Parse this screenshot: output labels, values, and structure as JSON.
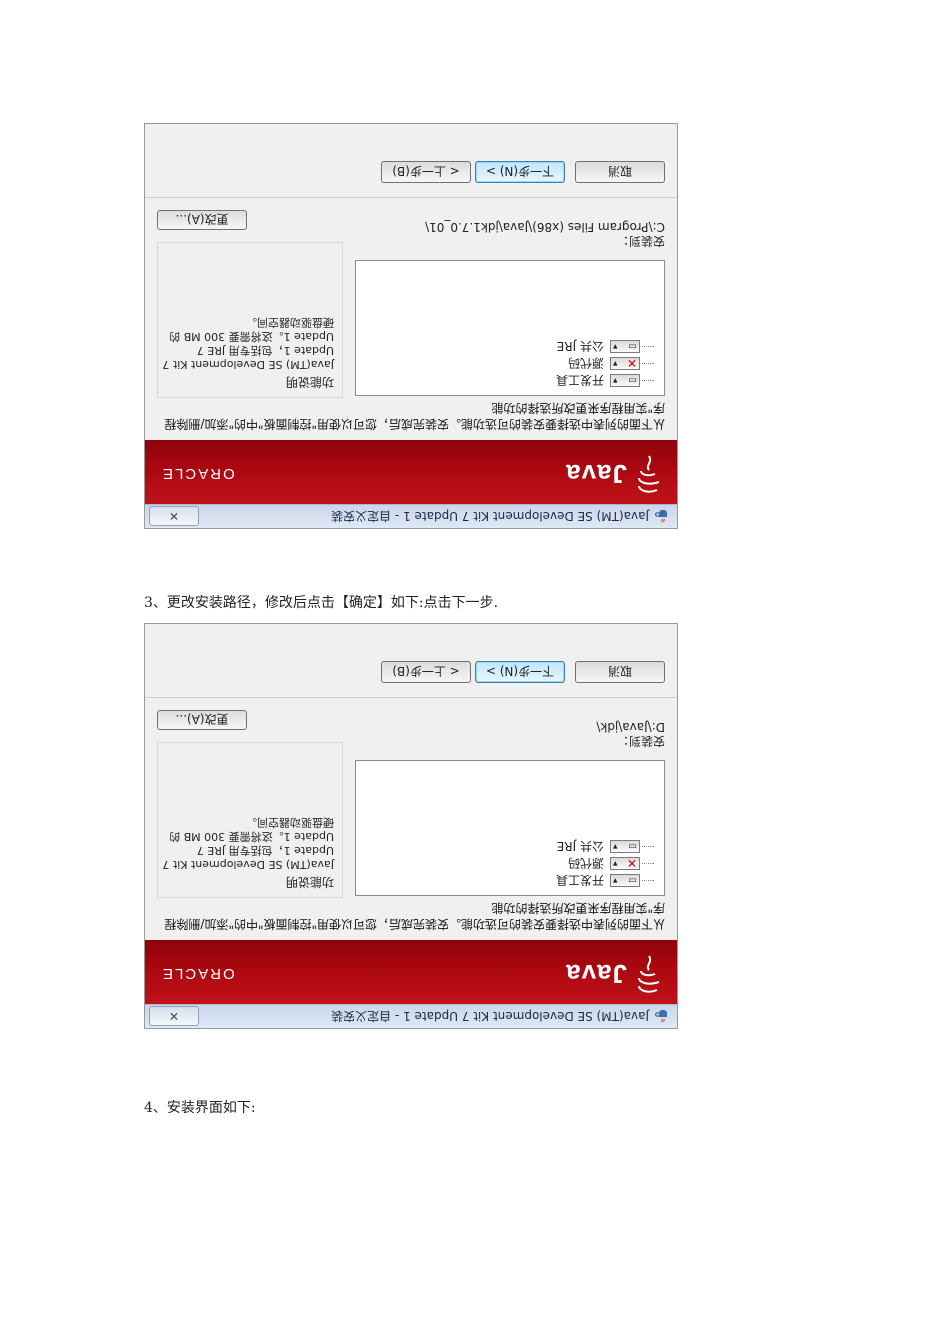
{
  "screenshots": [
    {
      "window_title": "Java(TM) SE Development Kit 7 Update 1 - 自定义安装",
      "close_label": "✕",
      "brand": {
        "java": "Java",
        "oracle": "ORACLE"
      },
      "description": "从下面的列表中选择要安装的可选功能。安装完成后，您可以使用\"控制面板\"中的\"添加/删除程序\"实用程序来更改所选择的功能",
      "features": [
        "开发工具",
        "源代码",
        "公共 JRE"
      ],
      "feature_states": [
        "installed",
        "excluded",
        "installed"
      ],
      "info_title": "功能说明",
      "info_text": "Java(TM) SE Development Kit 7 Update 1，包括专用 JRE 7 Update 1。这将需要 300 MB 的硬盘驱动器空间。",
      "install_to_label": "安装到：",
      "install_path": "C:\\Program Files (x86)\\Java\\jdk1.7.0_01\\",
      "change_button": "更改(A)...",
      "buttons": {
        "back": "< 上一步(B)",
        "next": "下一步(N) >",
        "cancel": "取消"
      }
    },
    {
      "window_title": "Java(TM) SE Development Kit 7 Update 1 - 自定义安装",
      "close_label": "✕",
      "brand": {
        "java": "Java",
        "oracle": "ORACLE"
      },
      "description": "从下面的列表中选择要安装的可选功能。安装完成后，您可以使用\"控制面板\"中的\"添加/删除程序\"实用程序来更改所选择的功能",
      "features": [
        "开发工具",
        "源代码",
        "公共 JRE"
      ],
      "feature_states": [
        "installed",
        "excluded",
        "installed"
      ],
      "info_title": "功能说明",
      "info_text": "Java(TM) SE Development Kit 7 Update 1，包括专用 JRE 7 Update 1。这将需要 300 MB 的硬盘驱动器空间。",
      "install_to_label": "安装到：",
      "install_path": "D:\\Java\\jdk\\",
      "change_button": "更改(A)...",
      "buttons": {
        "back": "< 上一步(B)",
        "next": "下一步(N) >",
        "cancel": "取消"
      }
    }
  ],
  "captions": [
    "3、更改安装路径，修改后点击【确定】如下:点击下一步.",
    "4、安装界面如下:"
  ]
}
